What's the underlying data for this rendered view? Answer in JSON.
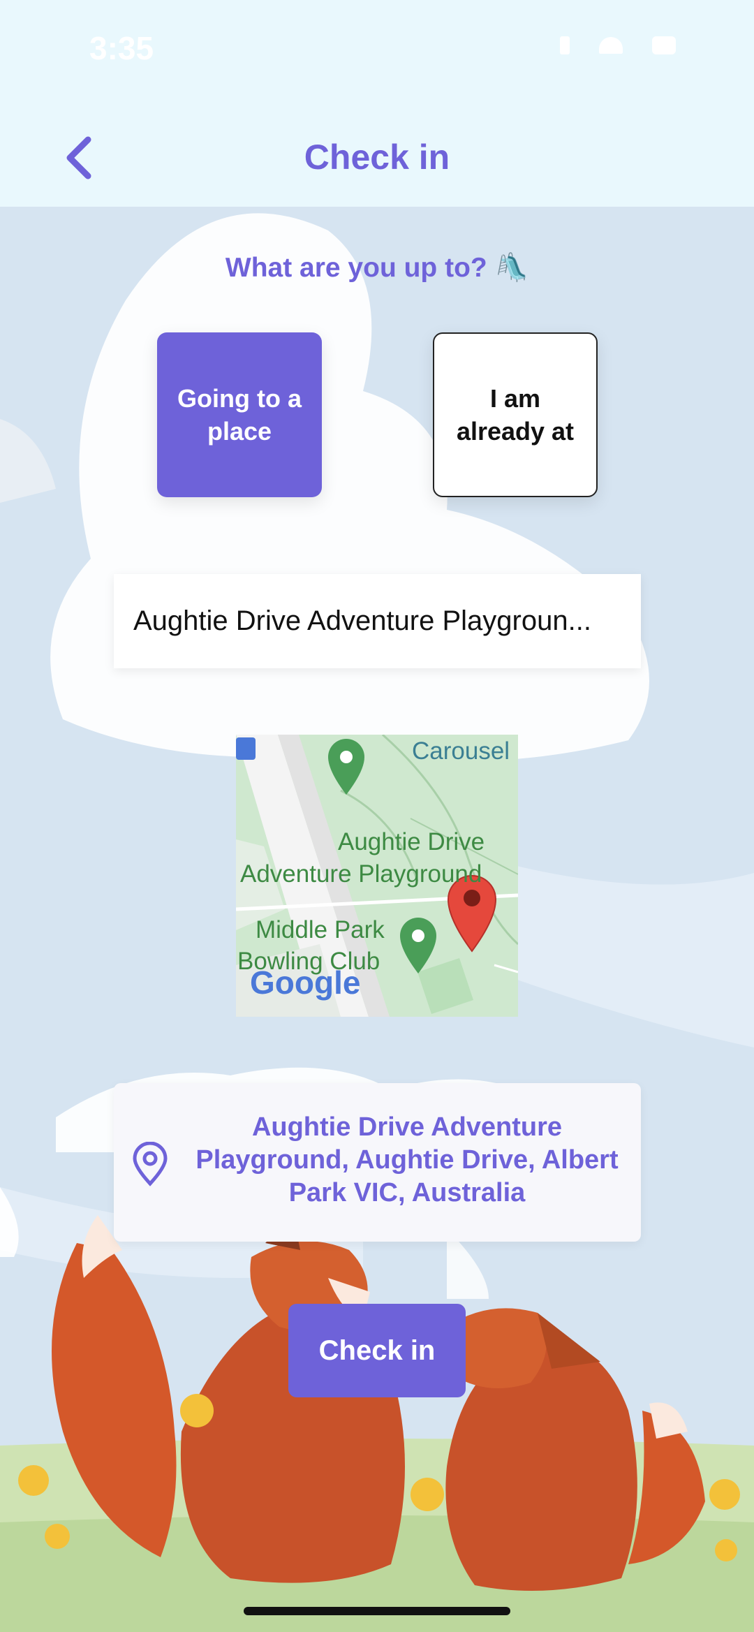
{
  "status_bar": {
    "time": "3:35"
  },
  "header": {
    "title": "Check in"
  },
  "question": "What are you up to? 🛝",
  "choices": {
    "going": "Going to a place",
    "already": "I am already at"
  },
  "search": {
    "value": "Aughtie Drive Adventure Playgroun..."
  },
  "map": {
    "labels": {
      "carousel": "Carousel",
      "playground_line1": "Aughtie Drive",
      "playground_line2": "Adventure Playground",
      "bowling_line1": "Middle Park",
      "bowling_line2": "Bowling Club",
      "google": "Google"
    }
  },
  "address": "Aughtie Drive Adventure Playground, Aughtie Drive, Albert Park VIC, Australia",
  "checkin_button": "Check in",
  "colors": {
    "accent": "#6e62d9",
    "header_bg": "#e9f8fd"
  }
}
